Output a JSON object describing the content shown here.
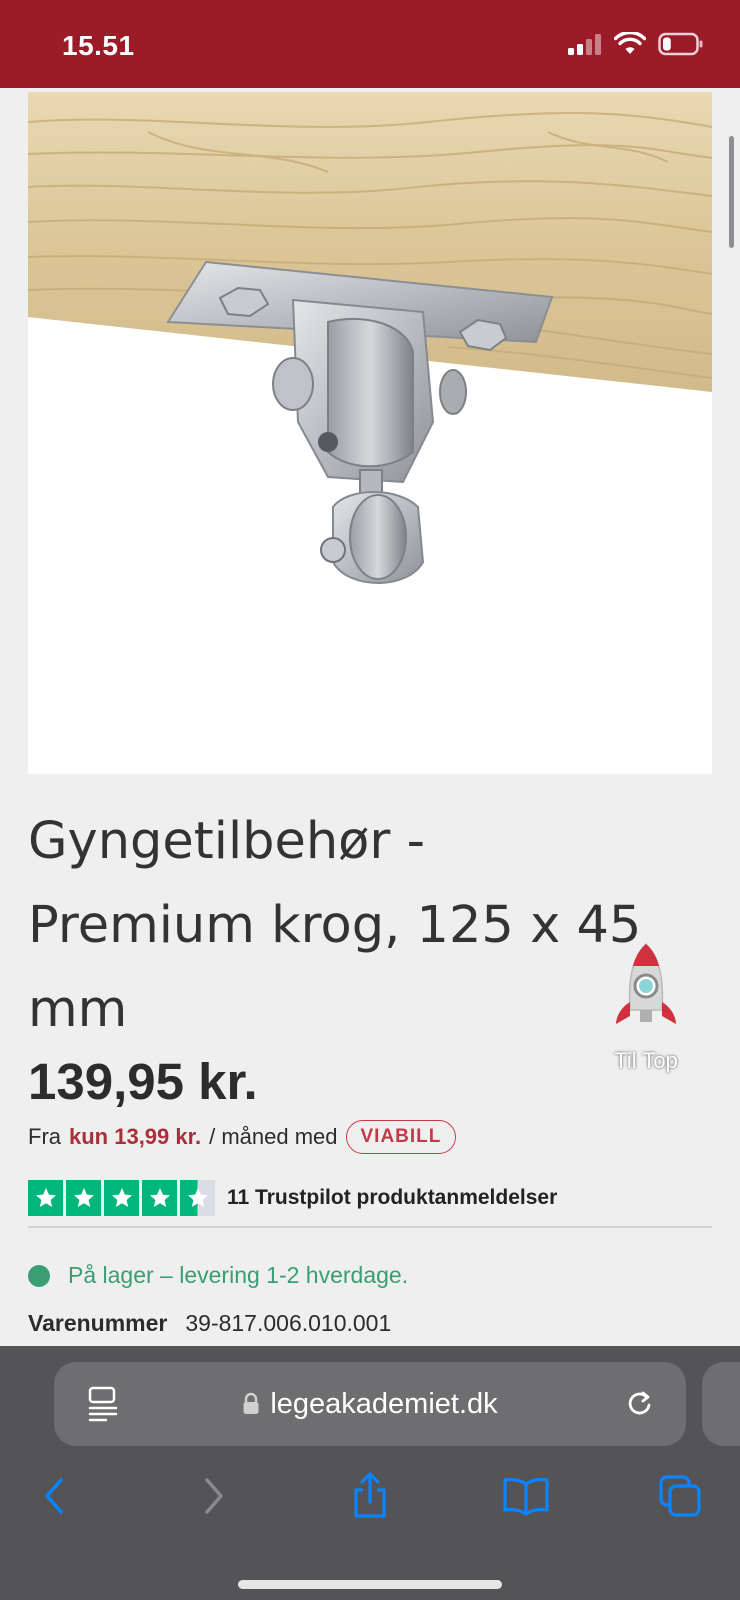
{
  "status_bar": {
    "time": "15.51",
    "background": "#9c1b28",
    "battery_level": 0.25
  },
  "product": {
    "title": "Gyngetilbehør - Premium krog, 125 x 45 mm",
    "price": "139,95 kr.",
    "image_icon": "swing-hook-product-image"
  },
  "installment": {
    "prefix": "Fra",
    "amount": "kun 13,99 kr.",
    "suffix": "/ måned med",
    "provider": "VIABILL",
    "accent": "#a8303a"
  },
  "rocket": {
    "label": "Til Top"
  },
  "trustpilot": {
    "rating": 4.5,
    "max": 5,
    "text": "11 Trustpilot produktanmeldelser",
    "color": "#00b67a"
  },
  "stock": {
    "text": "På lager – levering 1-2 hverdage.",
    "color": "#3b9e72"
  },
  "sku": {
    "label": "Varenummer",
    "value": "39-817.006.010.001"
  },
  "browser": {
    "url": "legeakademiet.dk",
    "icons": [
      "reader-mode-icon",
      "lock-icon",
      "reload-icon",
      "back-icon",
      "forward-icon",
      "share-icon",
      "bookmarks-icon",
      "tabs-icon"
    ],
    "accent": "#0a84ff"
  }
}
